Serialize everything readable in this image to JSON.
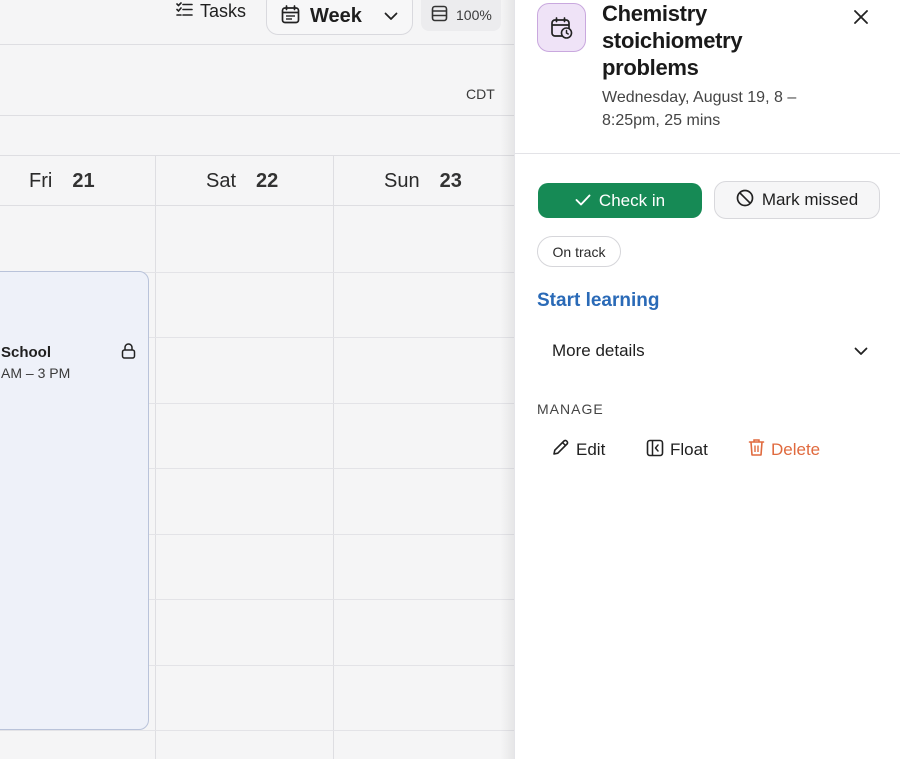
{
  "calendar": {
    "toolbar": {
      "tasks_label": "Tasks",
      "view_label": "Week",
      "zoom_label": "100%"
    },
    "timezone": "CDT",
    "days": [
      {
        "name": "Fri",
        "num": "21"
      },
      {
        "name": "Sat",
        "num": "22"
      },
      {
        "name": "Sun",
        "num": "23"
      }
    ],
    "event": {
      "title": "School",
      "time": "AM – 3 PM"
    }
  },
  "panel": {
    "title": "Chemistry stoichiometry problems",
    "when": "Wednesday, August 19, 8 – 8:25pm, 25 mins",
    "check_in_label": "Check in",
    "mark_missed_label": "Mark missed",
    "status": "On track",
    "start_learning_label": "Start learning",
    "more_details_label": "More details",
    "manage_label": "MANAGE",
    "actions": {
      "edit": "Edit",
      "float": "Float",
      "delete": "Delete"
    }
  },
  "colors": {
    "check_in_bg": "#168a55",
    "link": "#2a6ab7",
    "delete": "#e06a3e",
    "event_icon_bg": "#efe3f7"
  }
}
